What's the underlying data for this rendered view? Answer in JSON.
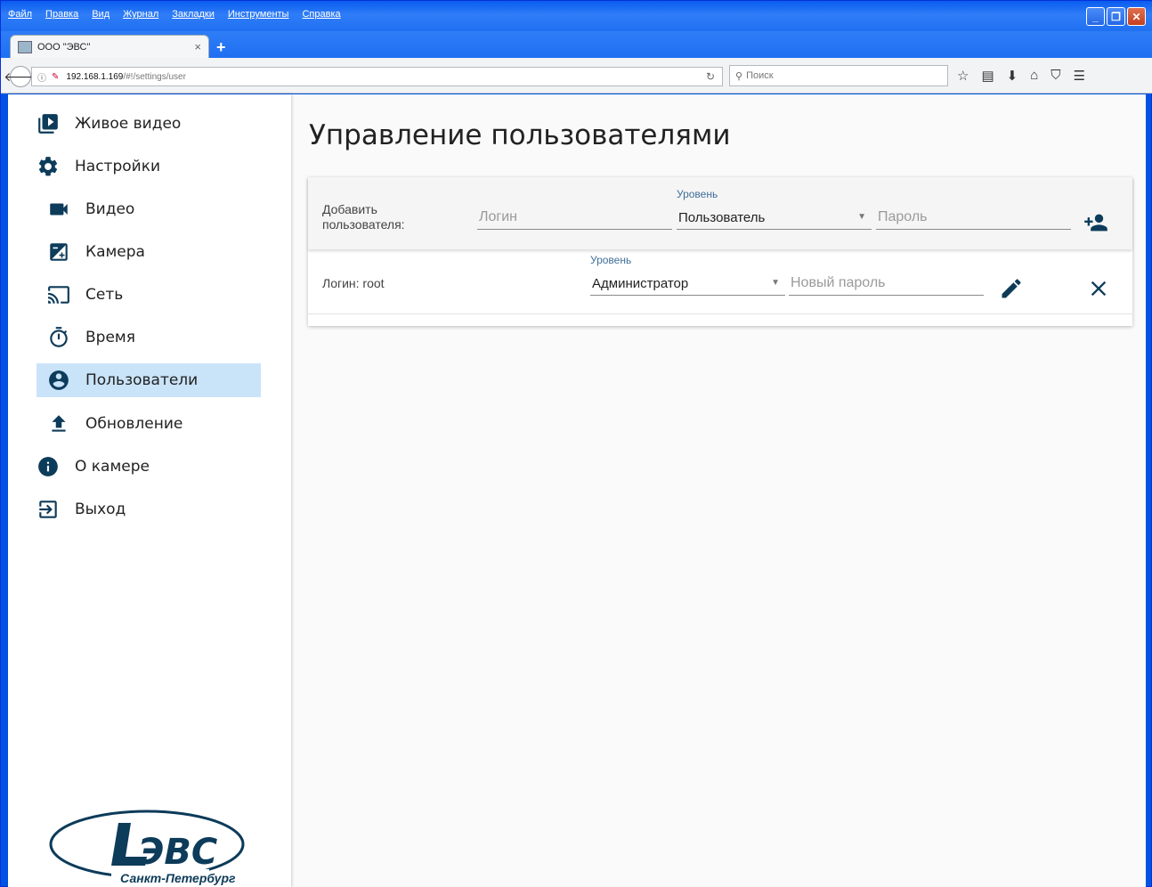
{
  "browser": {
    "menu": [
      "Файл",
      "Правка",
      "Вид",
      "Журнал",
      "Закладки",
      "Инструменты",
      "Справка"
    ],
    "tab_title": "ООО \"ЭВС\"",
    "tab_close": "×",
    "new_tab": "+",
    "url_host": "192.168.1.169",
    "url_path": "/#!/settings/user",
    "search_placeholder": "Поиск"
  },
  "sidebar": {
    "items": [
      {
        "label": "Живое видео",
        "icon": "live-video-icon"
      },
      {
        "label": "Настройки",
        "icon": "gear-icon"
      },
      {
        "label": "Видео",
        "icon": "videocam-icon"
      },
      {
        "label": "Камера",
        "icon": "camera-exposure-icon"
      },
      {
        "label": "Сеть",
        "icon": "cast-icon"
      },
      {
        "label": "Время",
        "icon": "timer-icon"
      },
      {
        "label": "Пользователи",
        "icon": "account-circle-icon",
        "active": true
      },
      {
        "label": "Обновление",
        "icon": "upload-icon"
      },
      {
        "label": "О камере",
        "icon": "info-icon"
      },
      {
        "label": "Выход",
        "icon": "exit-icon"
      }
    ],
    "logo_text": "ЭВС",
    "logo_city": "Санкт-Петербург"
  },
  "main": {
    "title": "Управление пользователями",
    "add_row": {
      "label": "Добавить пользователя:",
      "login_placeholder": "Логин",
      "level_label": "Уровень",
      "level_value": "Пользователь",
      "password_placeholder": "Пароль"
    },
    "users": [
      {
        "login_label": "Логин: root",
        "level_label": "Уровень",
        "level_value": "Администратор",
        "new_password_placeholder": "Новый пароль"
      }
    ]
  },
  "colors": {
    "accent": "#0d3b5a",
    "active_bg": "#c9e3f9",
    "float_label": "#3f6f9a"
  }
}
